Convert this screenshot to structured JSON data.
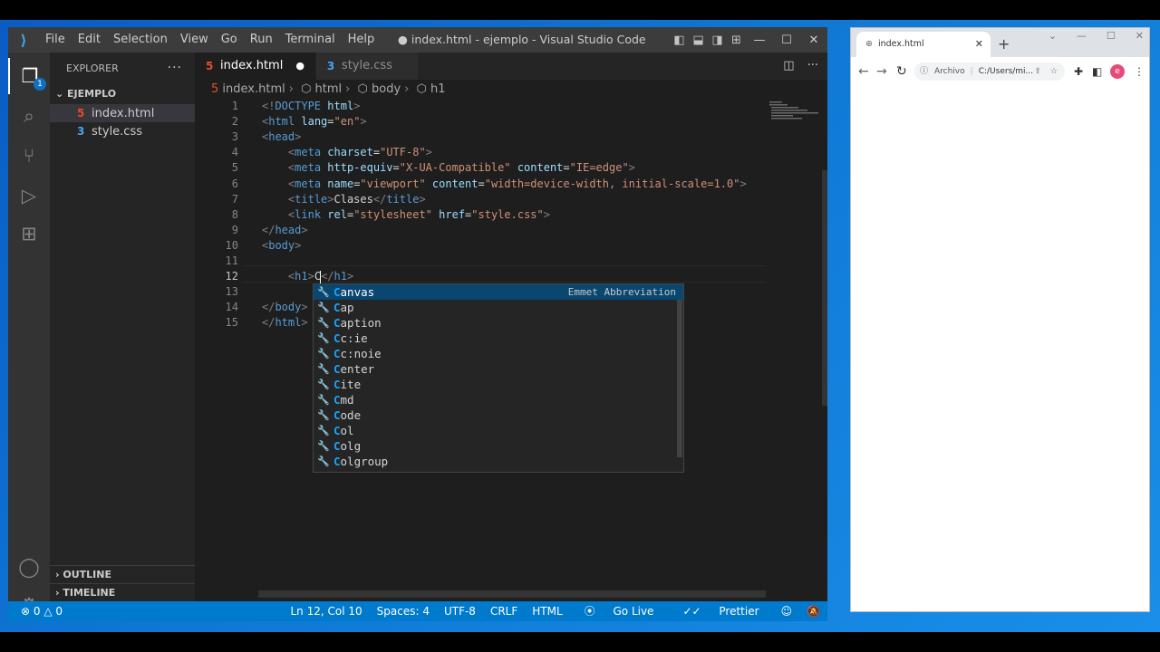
{
  "vscode": {
    "menu": [
      "File",
      "Edit",
      "Selection",
      "View",
      "Go",
      "Run",
      "Terminal",
      "Help"
    ],
    "window_title": "● index.html - ejemplo - Visual Studio Code",
    "activity_badge": "1",
    "explorer": {
      "header": "EXPLORER",
      "folder": "EJEMPLO",
      "files": [
        {
          "name": "index.html",
          "icon": "html-file-icon",
          "color": "#e44d26"
        },
        {
          "name": "style.css",
          "icon": "css-file-icon",
          "color": "#42a5f5"
        }
      ],
      "outline": "OUTLINE",
      "timeline": "TIMELINE"
    },
    "tabs": [
      {
        "label": "index.html",
        "modified": "●",
        "icon": "html-file-icon"
      },
      {
        "label": "style.css",
        "icon": "css-file-icon"
      }
    ],
    "breadcrumb": [
      "index.html",
      "html",
      "body",
      "h1"
    ],
    "code_lines": [
      {
        "n": "1",
        "tokens": [
          [
            "p",
            "<!"
          ],
          [
            "t",
            "DOCTYPE"
          ],
          [
            "x",
            " "
          ],
          [
            "a",
            "html"
          ],
          [
            "p",
            ">"
          ]
        ]
      },
      {
        "n": "2",
        "tokens": [
          [
            "p",
            "<"
          ],
          [
            "t",
            "html"
          ],
          [
            "x",
            " "
          ],
          [
            "a",
            "lang"
          ],
          [
            "x",
            "="
          ],
          [
            "s",
            "\"en\""
          ],
          [
            "p",
            ">"
          ]
        ]
      },
      {
        "n": "3",
        "tokens": [
          [
            "p",
            "<"
          ],
          [
            "t",
            "head"
          ],
          [
            "p",
            ">"
          ]
        ]
      },
      {
        "n": "4",
        "tokens": [
          [
            "x",
            "    "
          ],
          [
            "p",
            "<"
          ],
          [
            "t",
            "meta"
          ],
          [
            "x",
            " "
          ],
          [
            "a",
            "charset"
          ],
          [
            "x",
            "="
          ],
          [
            "s",
            "\"UTF-8\""
          ],
          [
            "p",
            ">"
          ]
        ]
      },
      {
        "n": "5",
        "tokens": [
          [
            "x",
            "    "
          ],
          [
            "p",
            "<"
          ],
          [
            "t",
            "meta"
          ],
          [
            "x",
            " "
          ],
          [
            "a",
            "http-equiv"
          ],
          [
            "x",
            "="
          ],
          [
            "s",
            "\"X-UA-Compatible\""
          ],
          [
            "x",
            " "
          ],
          [
            "a",
            "content"
          ],
          [
            "x",
            "="
          ],
          [
            "s",
            "\"IE=edge\""
          ],
          [
            "p",
            ">"
          ]
        ]
      },
      {
        "n": "6",
        "tokens": [
          [
            "x",
            "    "
          ],
          [
            "p",
            "<"
          ],
          [
            "t",
            "meta"
          ],
          [
            "x",
            " "
          ],
          [
            "a",
            "name"
          ],
          [
            "x",
            "="
          ],
          [
            "s",
            "\"viewport\""
          ],
          [
            "x",
            " "
          ],
          [
            "a",
            "content"
          ],
          [
            "x",
            "="
          ],
          [
            "s",
            "\"width=device-width, initial-scale=1.0\""
          ],
          [
            "p",
            ">"
          ]
        ]
      },
      {
        "n": "7",
        "tokens": [
          [
            "x",
            "    "
          ],
          [
            "p",
            "<"
          ],
          [
            "t",
            "title"
          ],
          [
            "p",
            ">"
          ],
          [
            "x",
            "Clases"
          ],
          [
            "p",
            "</"
          ],
          [
            "t",
            "title"
          ],
          [
            "p",
            ">"
          ]
        ]
      },
      {
        "n": "8",
        "tokens": [
          [
            "x",
            "    "
          ],
          [
            "p",
            "<"
          ],
          [
            "t",
            "link"
          ],
          [
            "x",
            " "
          ],
          [
            "a",
            "rel"
          ],
          [
            "x",
            "="
          ],
          [
            "s",
            "\"stylesheet\""
          ],
          [
            "x",
            " "
          ],
          [
            "a",
            "href"
          ],
          [
            "x",
            "="
          ],
          [
            "s",
            "\"style.css\""
          ],
          [
            "p",
            ">"
          ]
        ]
      },
      {
        "n": "9",
        "tokens": [
          [
            "p",
            "</"
          ],
          [
            "t",
            "head"
          ],
          [
            "p",
            ">"
          ]
        ]
      },
      {
        "n": "10",
        "tokens": [
          [
            "p",
            "<"
          ],
          [
            "t",
            "body"
          ],
          [
            "p",
            ">"
          ]
        ]
      },
      {
        "n": "11",
        "tokens": []
      },
      {
        "n": "12",
        "tokens": [
          [
            "x",
            "    "
          ],
          [
            "p",
            "<"
          ],
          [
            "t",
            "h1"
          ],
          [
            "p",
            ">"
          ],
          [
            "x",
            "C"
          ],
          [
            "c",
            ""
          ],
          [
            "p",
            "</"
          ],
          [
            "t",
            "h1"
          ],
          [
            "p",
            ">"
          ]
        ]
      },
      {
        "n": "13",
        "tokens": []
      },
      {
        "n": "14",
        "tokens": [
          [
            "p",
            "</"
          ],
          [
            "t",
            "body"
          ],
          [
            "p",
            ">"
          ]
        ]
      },
      {
        "n": "15",
        "tokens": [
          [
            "p",
            "</"
          ],
          [
            "t",
            "html"
          ],
          [
            "p",
            ">"
          ]
        ]
      }
    ],
    "current_line": "12",
    "suggestions": {
      "detail": "Emmet Abbreviation",
      "items": [
        "Canvas",
        "Cap",
        "Caption",
        "Cc:ie",
        "Cc:noie",
        "Center",
        "Cite",
        "Cmd",
        "Code",
        "Col",
        "Colg",
        "Colgroup"
      ]
    },
    "status": {
      "errors": "0",
      "warnings": "0",
      "position": "Ln 12, Col 10",
      "spaces": "Spaces: 4",
      "encoding": "UTF-8",
      "eol": "CRLF",
      "language": "HTML",
      "golive": "Go Live",
      "prettier": "Prettier"
    }
  },
  "chrome": {
    "tab_title": "index.html",
    "omnibox_label": "Archivo",
    "omnibox_path": "C:/Users/mi...",
    "profile_initial": "e"
  },
  "colors": {
    "vscode_accent": "#007acc",
    "suggest_highlight": "#18a3ff",
    "desktop": "#0f78d4"
  }
}
